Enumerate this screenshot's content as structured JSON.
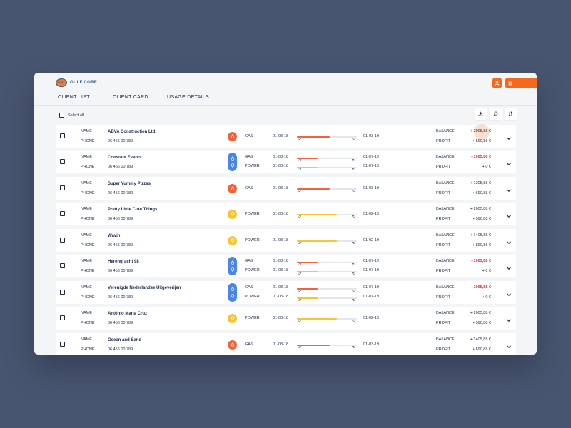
{
  "app": {
    "brand": "GULF CORE",
    "logo_text": "Gulf"
  },
  "tabs": [
    {
      "label": "CLIENT LIST",
      "active": true
    },
    {
      "label": "CLIENT CARD",
      "active": false
    },
    {
      "label": "USAGE DETAILS",
      "active": false
    }
  ],
  "toolbar": {
    "select_all_label": "Select all",
    "icons": [
      "download-icon",
      "search-icon",
      "sort-icon"
    ]
  },
  "labels": {
    "name": "NAME",
    "phone": "PHONE",
    "balance": "BALANCE",
    "profit": "PROFIT"
  },
  "colors": {
    "accent": "#f36a1f",
    "gas": "#f4623a",
    "power": "#f7c531",
    "multi": "#4a86e8",
    "negative": "#e0262d",
    "background": "#485570"
  },
  "clients": [
    {
      "name": "ABVA Construction Ltd.",
      "phone": "06 456 00 789",
      "utilities": [
        {
          "type": "GAS",
          "start": "01-03-18",
          "end": "01-03-19",
          "progress": 0.55
        }
      ],
      "balance": "+ 2005,88 €",
      "balance_negative": false,
      "profit": "+ 590,88 €"
    },
    {
      "name": "Constant Events",
      "phone": "06 456 00 789",
      "utilities": [
        {
          "type": "GAS",
          "start": "01-03-18",
          "end": "01-07-19",
          "progress": 0.34
        },
        {
          "type": "POWER",
          "start": "01-03-18",
          "end": "01-07-19",
          "progress": 0.34
        }
      ],
      "balance": "- 1005,88 €",
      "balance_negative": true,
      "profit": "+ 0 €"
    },
    {
      "name": "Super Yummy Pizzas",
      "phone": "06 456 00 789",
      "utilities": [
        {
          "type": "GAS",
          "start": "01-03-18",
          "end": "01-03-19",
          "progress": 0.55
        }
      ],
      "balance": "+ 1205,88 €",
      "balance_negative": false,
      "profit": "+ 690,88 €"
    },
    {
      "name": "Pretty Little Cute Things",
      "phone": "06 456 00 789",
      "utilities": [
        {
          "type": "POWER",
          "start": "01-03-18",
          "end": "01-02-19",
          "progress": 0.67
        }
      ],
      "balance": "+ 2005,88 €",
      "balance_negative": false,
      "profit": "+ 590,88 €"
    },
    {
      "name": "Wavin",
      "phone": "06 456 00 789",
      "utilities": [
        {
          "type": "POWER",
          "start": "01-03-18",
          "end": "01-02-19",
          "progress": 0.67
        }
      ],
      "balance": "+ 1405,88 €",
      "balance_negative": false,
      "profit": "+ 890,88 €"
    },
    {
      "name": "Herengracht 98",
      "phone": "06 456 00 789",
      "utilities": [
        {
          "type": "GAS",
          "start": "01-03-18",
          "end": "01-07-19",
          "progress": 0.34
        },
        {
          "type": "POWER",
          "start": "01-03-18",
          "end": "01-07-19",
          "progress": 0.34
        }
      ],
      "balance": "- 1005,88 €",
      "balance_negative": true,
      "profit": "+ 0 €"
    },
    {
      "name": "Verenigde Nederlandse Uitgeverijen",
      "phone": "06 456 00 789",
      "utilities": [
        {
          "type": "GAS",
          "start": "01-03-18",
          "end": "01-07-19",
          "progress": 0.34
        },
        {
          "type": "POWER",
          "start": "01-03-18",
          "end": "01-07-19",
          "progress": 0.34
        }
      ],
      "balance": "- 1005,88 €",
      "balance_negative": true,
      "profit": "+ 0 €"
    },
    {
      "name": "António Maria Cruz",
      "phone": "06 456 00 789",
      "utilities": [
        {
          "type": "POWER",
          "start": "01-03-18",
          "end": "01-02-19",
          "progress": 0.67
        }
      ],
      "balance": "+ 2005,88 €",
      "balance_negative": false,
      "profit": "+ 590,88 €"
    },
    {
      "name": "Ocean and Sand",
      "phone": "06 456 00 789",
      "utilities": [
        {
          "type": "GAS",
          "start": "01-03-18",
          "end": "01-03-19",
          "progress": 0.55
        }
      ],
      "balance": "+ 1405,88 €",
      "balance_negative": false,
      "profit": "+ 690,88 €"
    }
  ]
}
